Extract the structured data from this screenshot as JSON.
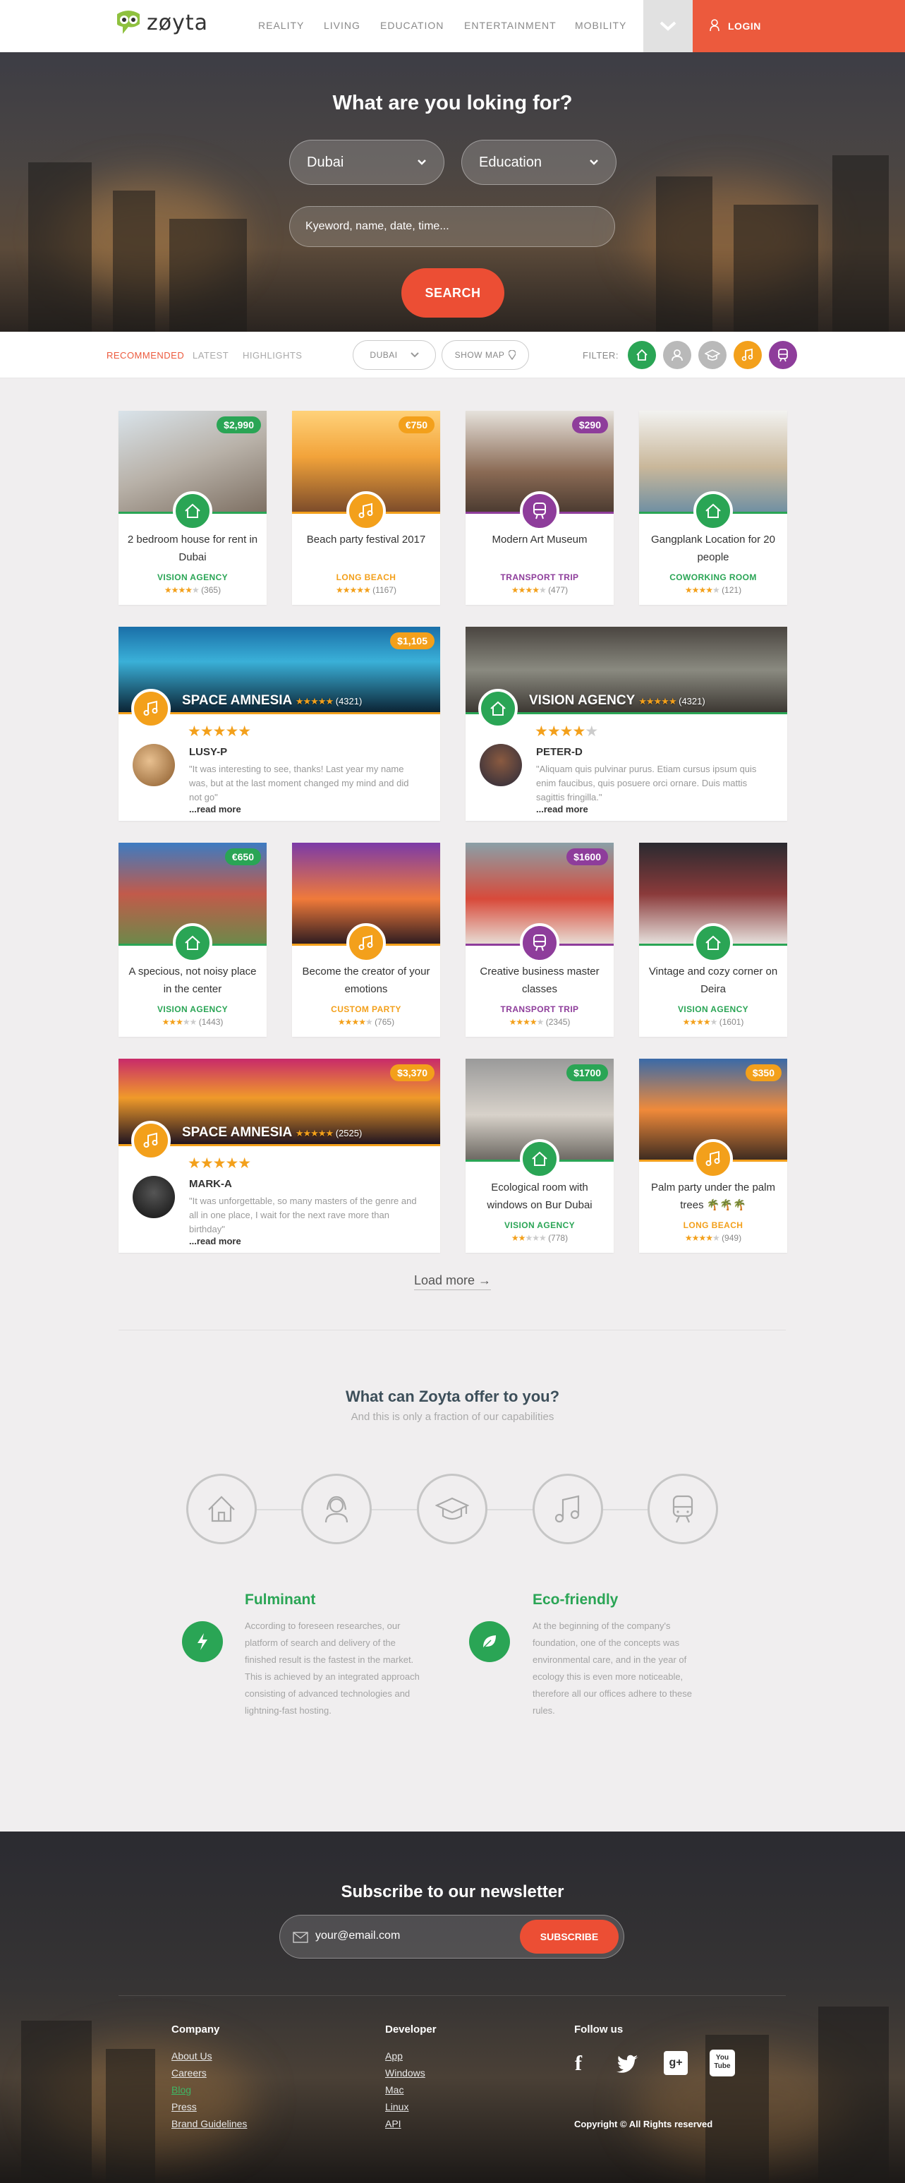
{
  "header": {
    "logo_text": "zøyta",
    "nav": [
      "REALITY",
      "LIVING",
      "EDUCATION",
      "ENTERTAINMENT",
      "MOBILITY"
    ],
    "login_label": "LOGIN"
  },
  "hero": {
    "title": "What are you loking for?",
    "city_value": "Dubai",
    "category_value": "Education",
    "keyword_placeholder": "Kyeword, name, date, time...",
    "search_label": "SEARCH"
  },
  "filterbar": {
    "tabs": [
      "RECOMMENDED",
      "LATEST",
      "HIGHLIGHTS"
    ],
    "city": "DUBAI",
    "show_map": "SHOW MAP",
    "filter_label": "FILTER:"
  },
  "colors": {
    "accent": "#ec5a3d",
    "green": "#2aa555",
    "orange": "#f3a01b",
    "purple": "#8e3d9b",
    "gray": "#b9b9b9"
  },
  "cards": [
    {
      "title": "2 bedroom house for rent in Dubai",
      "price": "$2,990",
      "agency": "VISION AGENCY",
      "rating": 4,
      "reviews": "(365)",
      "kind": "house",
      "color": "#2aa555"
    },
    {
      "title": "Beach party festival 2017",
      "price": "€750",
      "agency": "LONG BEACH",
      "rating": 5,
      "reviews": "(1167)",
      "kind": "music",
      "color": "#f3a01b"
    },
    {
      "title": "Modern Art Museum",
      "price": "$290",
      "agency": "TRANSPORT TRIP",
      "rating": 4,
      "reviews": "(477)",
      "kind": "train",
      "color": "#8e3d9b"
    },
    {
      "title": "Gangplank Location for 20 people",
      "price": "",
      "agency": "COWORKING ROOM",
      "rating": 4,
      "reviews": "(121)",
      "kind": "house",
      "color": "#2aa555"
    },
    {
      "title": "A specious, not noisy place in the center",
      "price": "€650",
      "agency": "VISION AGENCY",
      "rating": 3,
      "reviews": "(1443)",
      "kind": "house",
      "color": "#2aa555"
    },
    {
      "title": "Become the creator of your emotions",
      "price": "",
      "agency": "CUSTOM PARTY",
      "rating": 4,
      "reviews": "(765)",
      "kind": "music",
      "color": "#f3a01b"
    },
    {
      "title": "Creative business master classes",
      "price": "$1600",
      "agency": "TRANSPORT TRIP",
      "rating": 4,
      "reviews": "(2345)",
      "kind": "train",
      "color": "#8e3d9b"
    },
    {
      "title": "Vintage and cozy corner on Deira",
      "price": "",
      "agency": "VISION AGENCY",
      "rating": 4,
      "reviews": "(1601)",
      "kind": "house",
      "color": "#2aa555"
    },
    {
      "title": "Ecological room with windows on Bur Dubai",
      "price": "$1700",
      "agency": "VISION AGENCY",
      "rating": 2,
      "reviews": "(778)",
      "kind": "house",
      "color": "#2aa555"
    },
    {
      "title": "Palm party under the palm trees 🌴🌴🌴",
      "price": "$350",
      "agency": "LONG BEACH",
      "rating": 4,
      "reviews": "(949)",
      "kind": "music",
      "color": "#f3a01b"
    }
  ],
  "wide_cards": [
    {
      "name": "SPACE AMNESIA",
      "count": "(4321)",
      "price": "$1,105",
      "user": "LUSY-P",
      "quote": "\"It was interesting to see, thanks! Last year my name was, but at the last moment changed my mind and did not go\"",
      "more": "...read more",
      "kind": "music",
      "color": "#f3a01b",
      "rating": 5
    },
    {
      "name": "VISION AGENCY",
      "count": "(4321)",
      "price": "",
      "user": "PETER-D",
      "quote": "\"Aliquam quis pulvinar purus. Etiam cursus ipsum quis enim faucibus, quis posuere orci ornare. Duis mattis sagittis fringilla.\"",
      "more": "...read more",
      "kind": "house",
      "color": "#2aa555",
      "rating": 4
    },
    {
      "name": "SPACE AMNESIA",
      "count": "(2525)",
      "price": "$3,370",
      "user": "MARK-A",
      "quote": "\"It was unforgettable, so many masters of the genre and all in one place, I wait for the next rave more than birthday\"",
      "more": "...read more",
      "kind": "music",
      "color": "#f3a01b",
      "rating": 5
    }
  ],
  "load_more": "Load more →",
  "offer": {
    "title": "What can Zoyta offer to you?",
    "subtitle": "And this is only a fraction of our capabilities",
    "features": [
      {
        "title": "Fulminant",
        "text": "According to foreseen researches, our platform of search and delivery of the finished result is the fastest in the market. This is achieved by an integrated approach consisting of advanced technologies and lightning-fast hosting."
      },
      {
        "title": "Eco-friendly",
        "text": "At the beginning of the company's foundation, one of the concepts was environmental care, and in the year of ecology this is even more noticeable, therefore all our offices adhere to these rules."
      }
    ]
  },
  "footer": {
    "newsletter_title": "Subscribe to our newsletter",
    "email_placeholder": "your@email.com",
    "subscribe_label": "SUBSCRIBE",
    "company_title": "Company",
    "company_links": [
      "About Us",
      "Careers",
      "Blog",
      "Press",
      "Brand Guidelines"
    ],
    "developer_title": "Developer",
    "developer_links": [
      "App",
      "Windows",
      "Mac",
      "Linux",
      "API"
    ],
    "follow_title": "Follow us",
    "copyright": "Copyright © All Rights reserved"
  }
}
